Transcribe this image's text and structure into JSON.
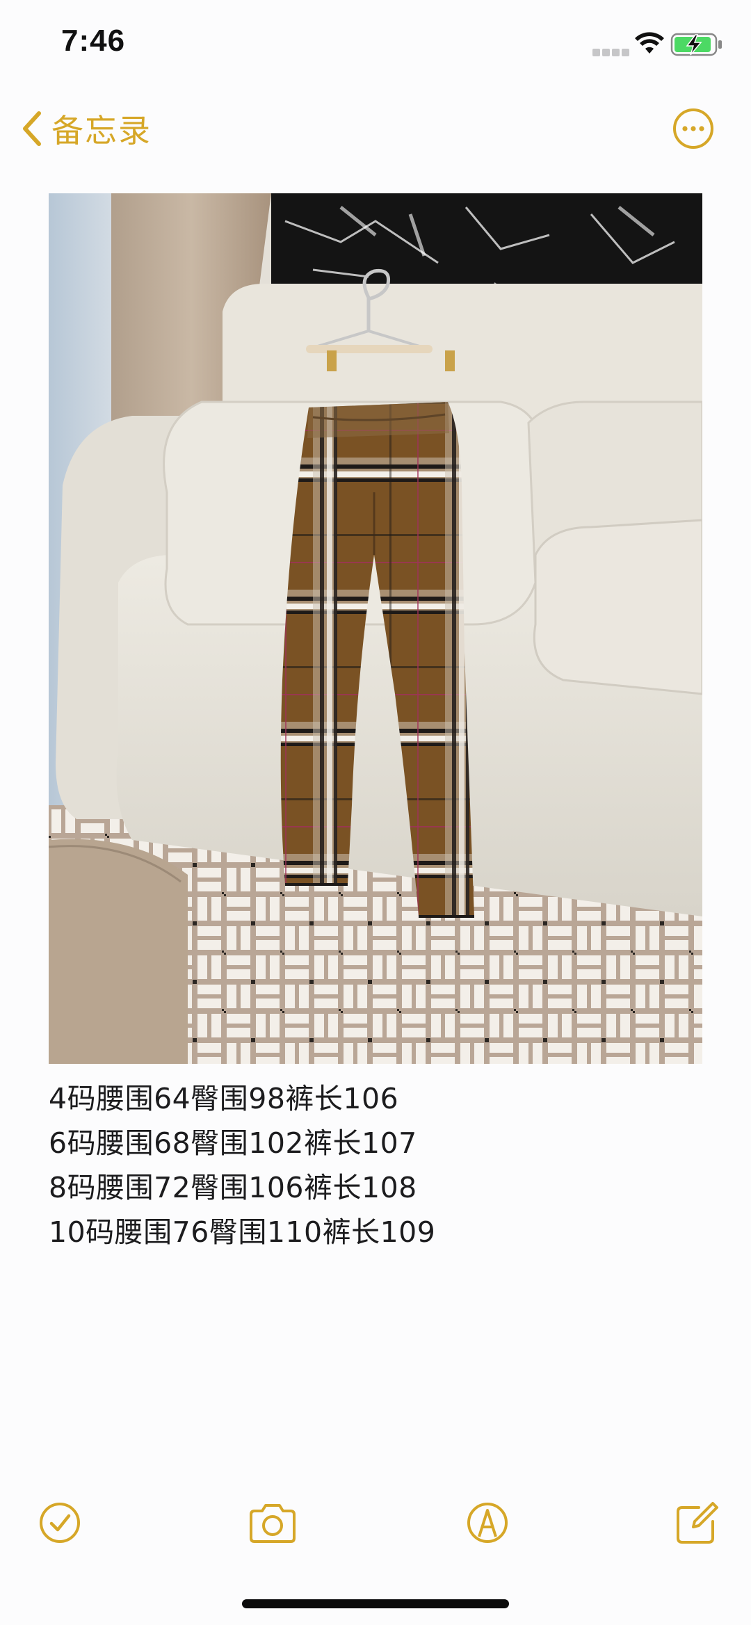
{
  "status_bar": {
    "time": "7:46",
    "icons": [
      "signal-dots-icon",
      "wifi-icon",
      "battery-charging-icon"
    ]
  },
  "nav": {
    "back_label": "备忘录",
    "back_icon": "chevron-left-icon",
    "more_icon": "ellipsis-circle-icon"
  },
  "note": {
    "image_alt": "photo-plaid-trousers-on-sofa",
    "lines": [
      "4码腰围64臀围98裤长106",
      "6码腰围68臀围102裤长107",
      "8码腰围72臀围106裤长108",
      "10码腰围76臀围110裤长109"
    ]
  },
  "toolbar": {
    "items": [
      "checklist-icon",
      "camera-icon",
      "markup-pen-icon",
      "compose-icon"
    ]
  },
  "colors": {
    "accent": "#d6a728",
    "text": "#1c1c1e",
    "background": "#fcfcfd"
  }
}
